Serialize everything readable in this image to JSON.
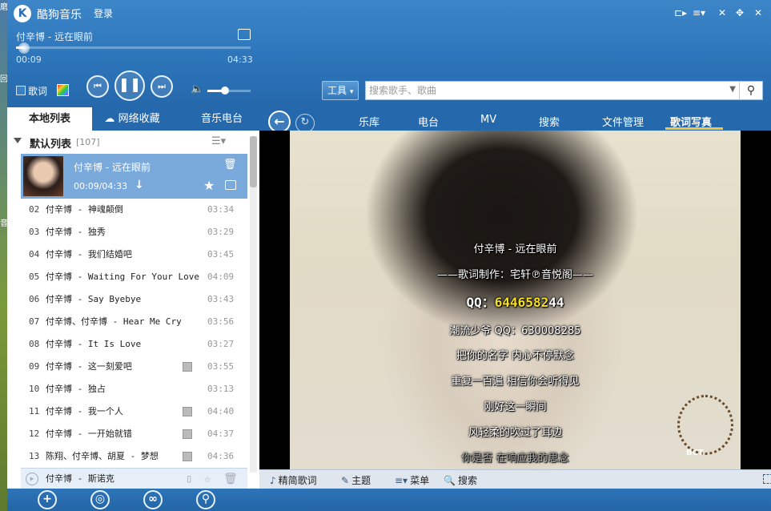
{
  "desktop": {
    "labels": [
      "磨",
      "回",
      "音"
    ]
  },
  "app": {
    "title": "酷狗音乐",
    "login": "登录",
    "logo_letter": "K"
  },
  "window_controls": [
    "⊏▸",
    "≡▾",
    "✕",
    "✥",
    "✕"
  ],
  "player": {
    "song_title": "付辛博 - 远在眼前",
    "current_time": "00:09",
    "total_time": "04:33",
    "progress_percent": 3.3,
    "volume_percent": 40,
    "lyric_toggle_label": "歌词",
    "prev_glyph": "⏮",
    "pause_glyph": "❚❚",
    "next_glyph": "⏭",
    "volume_glyph": "🔈"
  },
  "search": {
    "tools_label": "工具",
    "placeholder": "搜索歌手、歌曲"
  },
  "left_tabs": [
    {
      "label": "本地列表",
      "active": true
    },
    {
      "label": "网络收藏",
      "active": false
    },
    {
      "label": "音乐电台",
      "active": false
    }
  ],
  "playlist": {
    "name": "默认列表",
    "count": "[107]",
    "now_playing": {
      "title": "付辛博 - 远在眼前",
      "time": "00:09/04:33"
    },
    "rows": [
      {
        "num": "02",
        "title": "付辛博 - 神魂颠倒",
        "duration": "03:34",
        "mv": false
      },
      {
        "num": "03",
        "title": "付辛博 - 独秀",
        "duration": "03:29",
        "mv": false
      },
      {
        "num": "04",
        "title": "付辛博 - 我们结婚吧",
        "duration": "03:45",
        "mv": false
      },
      {
        "num": "05",
        "title": "付辛博 - Waiting For Your Love",
        "duration": "04:09",
        "mv": false
      },
      {
        "num": "06",
        "title": "付辛博 - Say Byebye",
        "duration": "03:43",
        "mv": false
      },
      {
        "num": "07",
        "title": "付辛博、付辛博 - Hear Me Cry",
        "duration": "03:56",
        "mv": false
      },
      {
        "num": "08",
        "title": "付辛博 - It Is Love",
        "duration": "03:27",
        "mv": false
      },
      {
        "num": "09",
        "title": "付辛博 - 这一刻爱吧",
        "duration": "03:55",
        "mv": true
      },
      {
        "num": "10",
        "title": "付辛博 - 独占",
        "duration": "03:13",
        "mv": false
      },
      {
        "num": "11",
        "title": "付辛博 - 我一个人",
        "duration": "04:40",
        "mv": true
      },
      {
        "num": "12",
        "title": "付辛博 - 一开始就错",
        "duration": "04:37",
        "mv": true
      },
      {
        "num": "13",
        "title": "陈翔、付辛博、胡夏 - 梦想",
        "duration": "04:36",
        "mv": true
      }
    ],
    "bottom_row": {
      "title": "付辛博 - 斯诺克"
    }
  },
  "nav_tabs": [
    {
      "label": "乐库",
      "active": false
    },
    {
      "label": "电台",
      "active": false
    },
    {
      "label": "MV",
      "active": false
    },
    {
      "label": "搜索",
      "active": false
    },
    {
      "label": "文件管理",
      "active": false
    },
    {
      "label": "歌词写真",
      "active": true
    }
  ],
  "lyrics": {
    "title_line": "付辛博 - 远在眼前",
    "maker_line": "——歌词制作：宅轩℗音悦阁——",
    "qq_prefix": "QQ：",
    "qq_highlight": "6446582",
    "qq_rest": "44",
    "lines": [
      "潮流少爷 QQ：630008285",
      "把你的名字 内心不停默念",
      "重复一百遍 相信你会听得见",
      "刚好这一瞬间",
      "风轻柔的吹过了耳边",
      "你是否 在响应我的思念"
    ],
    "photo_watermark": "BCT"
  },
  "lyric_toolbar": [
    {
      "label": "精简歌词",
      "icon": "♪"
    },
    {
      "label": "主题",
      "icon": "✎"
    },
    {
      "label": "菜单",
      "icon": "≡▾"
    },
    {
      "label": "搜索",
      "icon": "🔍"
    }
  ],
  "footer_buttons": [
    "+",
    "◎",
    "∞",
    "⚲"
  ]
}
